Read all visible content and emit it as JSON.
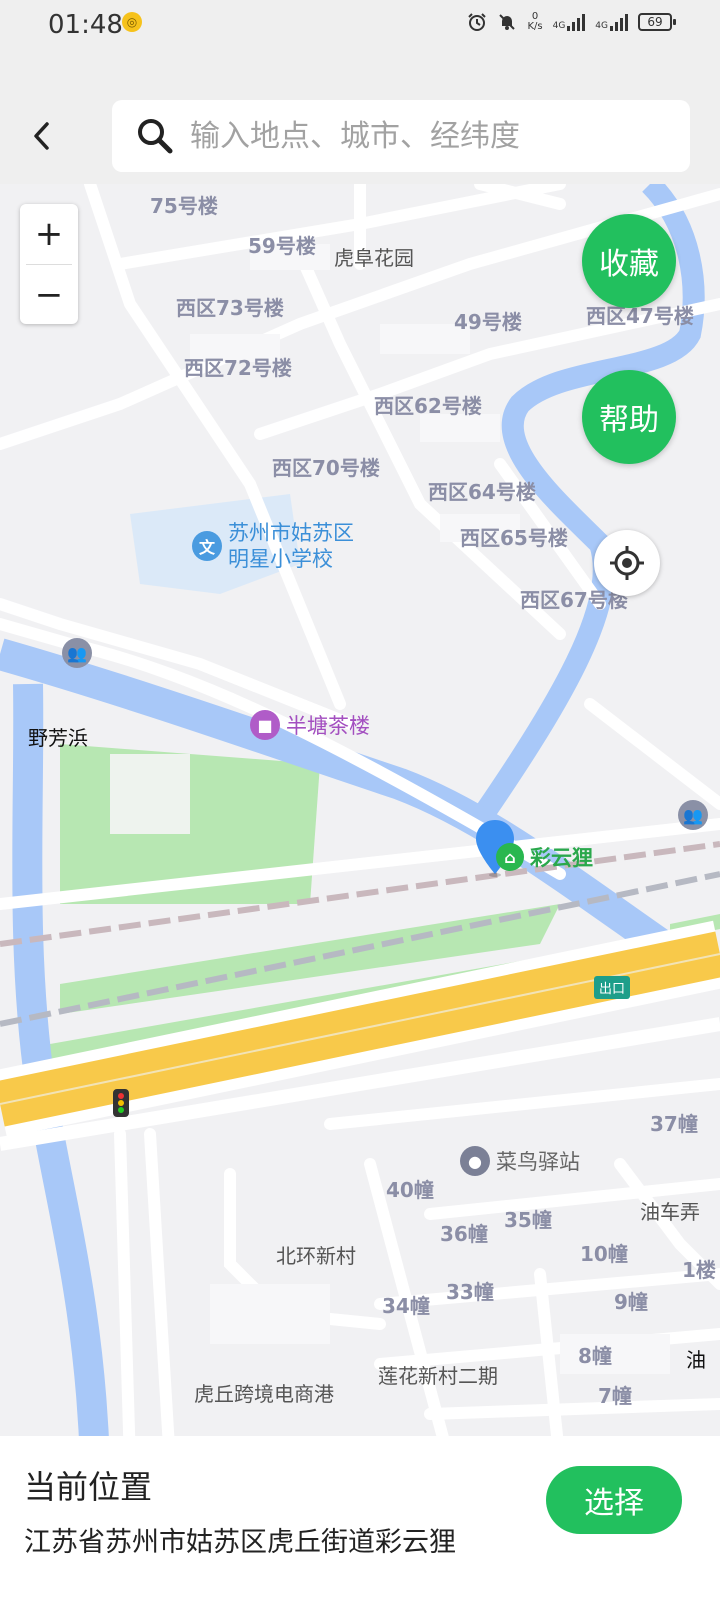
{
  "status_bar": {
    "time": "01:48",
    "net_speed_value": "0",
    "net_speed_unit": "K/s",
    "net_type_1": "4G",
    "net_type_2": "4G",
    "battery": "69"
  },
  "search": {
    "placeholder": "输入地点、城市、经纬度"
  },
  "map": {
    "zoom_in": "+",
    "zoom_out": "−",
    "favorite_label": "收藏",
    "help_label": "帮助",
    "labels": {
      "l75": "75号楼",
      "l59": "59号楼",
      "huafu": "虎阜花园",
      "w73": "西区73号楼",
      "b49": "49号楼",
      "w47": "西区47号楼",
      "w72": "西区72号楼",
      "w62": "西区62号楼",
      "w70": "西区70号楼",
      "w64": "西区64号楼",
      "w65": "西区65号楼",
      "w67": "西区67号楼",
      "school1": "苏州市姑苏区",
      "school2": "明星小学校",
      "yefang": "野芳浜",
      "banteng": "半塘茶楼",
      "caiyun": "彩云狸",
      "exit": "出口",
      "d37": "37幢",
      "cainiao": "菜鸟驿站",
      "d40": "40幢",
      "d36": "36幢",
      "d35": "35幢",
      "youche": "油车弄",
      "beihuan": "北环新村",
      "d10": "10幢",
      "d34": "34幢",
      "d33": "33幢",
      "d9": "9幢",
      "d1": "1楼",
      "d8": "8幢",
      "you": "油",
      "lianhua": "莲花新村二期",
      "huqiu": "虎丘跨境电商港",
      "d7": "7幢"
    }
  },
  "panel": {
    "title": "当前位置",
    "address": "江苏省苏州市姑苏区虎丘街道彩云狸",
    "select_label": "选择"
  },
  "colors": {
    "accent": "#22c05e",
    "water": "#a8c8f8",
    "expressway": "#f8c94a",
    "green": "#b5e6b0"
  }
}
